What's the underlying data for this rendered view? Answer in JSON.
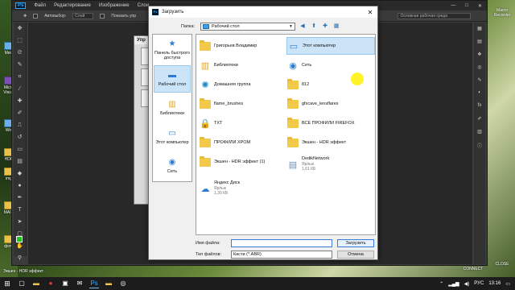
{
  "photoshop": {
    "logo": "Ps",
    "menu": [
      "Файл",
      "Редактирование",
      "Изображение",
      "Слои"
    ],
    "options": {
      "autoselect_label": "Автовыбор:",
      "autoselect_value": "Слой",
      "show_controls_label": "Показать упр",
      "workspace_label": "Основная рабочая среда"
    },
    "window_controls": [
      "—",
      "□",
      "✕"
    ],
    "bg_dialog_title": "Упр"
  },
  "dialog": {
    "title": "Загрузить",
    "folder_label": "Папка:",
    "folder_value": "Рабочий стол",
    "places": [
      {
        "label": "Панель быстрого доступа",
        "icon": "star-icon"
      },
      {
        "label": "Рабочий стол",
        "icon": "desktop-icon",
        "selected": true
      },
      {
        "label": "Библиотеки",
        "icon": "libraries-icon"
      },
      {
        "label": "Этот компьютер",
        "icon": "computer-icon"
      },
      {
        "label": "Сеть",
        "icon": "network-icon"
      }
    ],
    "files": [
      {
        "name": "Григорьев Владимир",
        "icon": "user-folder-icon",
        "col": 0,
        "row": 0
      },
      {
        "name": "Этот компьютер",
        "icon": "computer-icon",
        "col": 1,
        "row": 0,
        "selected": true
      },
      {
        "name": "Библиотеки",
        "icon": "libraries-icon",
        "col": 0,
        "row": 1
      },
      {
        "name": "Сеть",
        "icon": "network-icon",
        "col": 1,
        "row": 1
      },
      {
        "name": "Домашняя группа",
        "icon": "homegroup-icon",
        "col": 0,
        "row": 2
      },
      {
        "name": "812",
        "icon": "folder-icon",
        "col": 1,
        "row": 2
      },
      {
        "name": "flame_brushes",
        "icon": "folder-icon",
        "col": 0,
        "row": 3
      },
      {
        "name": "gfxcave_lensflares",
        "icon": "folder-icon",
        "col": 1,
        "row": 3
      },
      {
        "name": "TXT",
        "icon": "lock-folder-icon",
        "col": 0,
        "row": 4
      },
      {
        "name": "ВСЕ ПРОФИЛИ FIREFOX",
        "icon": "folder-icon",
        "col": 1,
        "row": 4
      },
      {
        "name": "ПРОФИЛИ ХРОМ",
        "icon": "folder-icon",
        "col": 0,
        "row": 5
      },
      {
        "name": "Экшен - HDR эффект",
        "icon": "folder-icon",
        "col": 1,
        "row": 5
      },
      {
        "name": "Экшен - HDR эффект (1)",
        "icon": "folder-icon",
        "col": 0,
        "row": 6
      },
      {
        "name": "DedikNetwork",
        "sub1": "Ярлык",
        "sub2": "1,61 КБ",
        "icon": "shortcut-icon",
        "col": 1,
        "row": 6
      },
      {
        "name": "Яндекс Диск",
        "sub1": "Ярлык",
        "sub2": "1,30 КБ",
        "icon": "yandex-disk-icon",
        "col": 0,
        "row": 7
      }
    ],
    "filename_label": "Имя файла:",
    "filename_value": "",
    "filetype_label": "Тип файлов:",
    "filetype_value": "Кисти (*.ABR)",
    "load_button": "Загрузить",
    "cancel_button": "Отмена"
  },
  "desktop_left": [
    "Medi",
    "Micro Visual",
    "Win",
    "HDR",
    "img",
    "MAIN",
    "фото"
  ],
  "desktop_right": [
    "Macro Recorder",
    "DEDIK CONNECT",
    "CLOSE"
  ],
  "bottom_left_labels": [
    "Экшен - HDR эффект"
  ],
  "taskbar": {
    "tray_lang": "РУС",
    "time": "13:16"
  }
}
